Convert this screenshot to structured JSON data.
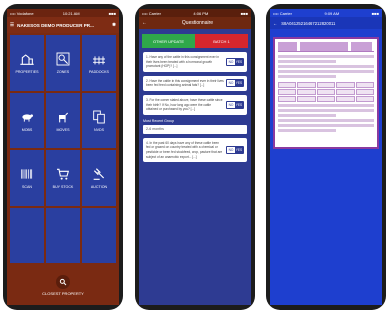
{
  "phone1": {
    "status": {
      "carrier": "•••• Vodafone",
      "time": "10:21 AM",
      "battery": "■■■"
    },
    "header": {
      "title": "NAKESOS DEMO PRODUCER PR...",
      "menu_icon": "hamburger-icon",
      "logo_icon": "dog-icon"
    },
    "tiles": [
      {
        "label": "PROPERTIES",
        "icon": "farm-icon"
      },
      {
        "label": "ZONES",
        "icon": "map-zone-icon"
      },
      {
        "label": "PADDOCKS",
        "icon": "paddock-icon"
      },
      {
        "label": "MOBS",
        "icon": "sheep-icon"
      },
      {
        "label": "MOVES",
        "icon": "cattle-icon"
      },
      {
        "label": "NVDS",
        "icon": "documents-icon"
      },
      {
        "label": "SCAN",
        "icon": "barcode-icon"
      },
      {
        "label": "BUY STOCK",
        "icon": "cart-icon"
      },
      {
        "label": "AUCTION",
        "icon": "gavel-icon"
      },
      {
        "label": "",
        "icon": ""
      },
      {
        "label": "",
        "icon": ""
      },
      {
        "label": "",
        "icon": ""
      }
    ],
    "bottom": {
      "label": "CLOSEST PROPERTY",
      "icon": "search-icon"
    }
  },
  "phone2": {
    "status": {
      "carrier": "•••• Carrier",
      "time": "4:06 PM",
      "battery": "■■■"
    },
    "header": {
      "title": "Questionnaire",
      "back_icon": "back-arrow-icon"
    },
    "tabs": {
      "left": "OTHER UPDATE",
      "right": "BATCH 1"
    },
    "questions": [
      {
        "text": "1. Have any of the cattle in this consignment ever in their lives been treated with a hormonal growth promotant (HGP)? [...]",
        "no": "NO",
        "yes": "YES"
      },
      {
        "text": "2. Have the cattle in this consignment ever in their lives been fed feed containing animal fats? [...]",
        "no": "NO",
        "yes": "YES"
      },
      {
        "text": "3. For the owner stated above, have these cattle since their birth? If No, how long ago were the cattle obtained or purchased by you? [...]",
        "no": "NO",
        "yes": "YES"
      }
    ],
    "input": {
      "label": "Most Recent Group",
      "value": "2-6 months"
    },
    "question4": {
      "text": "4. In the past 60 days have any of these cattle been fed or grazed on country treated with a chemical or pesticide or been fed stockfeed, crop, pasture that are subject of an anaerobic export... [...]",
      "no": "NO",
      "yes": "YES"
    }
  },
  "phone3": {
    "status": {
      "carrier": "•••• Carrier",
      "time": "9:09 AM",
      "battery": "■■■"
    },
    "header": {
      "title": "S8A04125216467212820011",
      "back_icon": "back-arrow-icon"
    }
  }
}
